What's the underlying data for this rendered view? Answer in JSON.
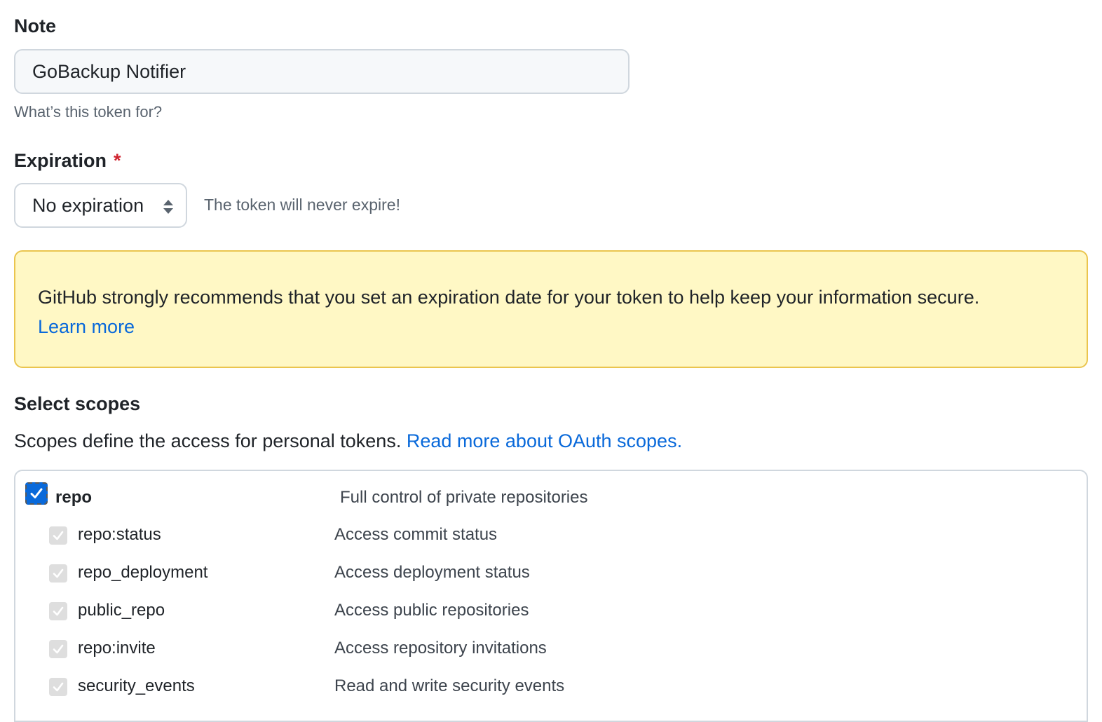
{
  "note": {
    "label": "Note",
    "value": "GoBackup Notifier",
    "hint": "What’s this token for?"
  },
  "expiration": {
    "label": "Expiration",
    "required_mark": "*",
    "selected": "No expiration",
    "hint": "The token will never expire!"
  },
  "warning": {
    "text": "GitHub strongly recommends that you set an expiration date for your token to help keep your information secure.",
    "link": "Learn more",
    "colors": {
      "background": "#fff8c5",
      "border": "#eac54f"
    }
  },
  "scopes": {
    "title": "Select scopes",
    "description": "Scopes define the access for personal tokens.",
    "link": "Read more about OAuth scopes.",
    "items": [
      {
        "name": "repo",
        "description": "Full control of private repositories",
        "checked": true
      },
      {
        "name": "repo:status",
        "description": "Access commit status",
        "checked": true
      },
      {
        "name": "repo_deployment",
        "description": "Access deployment status",
        "checked": true
      },
      {
        "name": "public_repo",
        "description": "Access public repositories",
        "checked": true
      },
      {
        "name": "repo:invite",
        "description": "Access repository invitations",
        "checked": true
      },
      {
        "name": "security_events",
        "description": "Read and write security events",
        "checked": true
      }
    ]
  },
  "colors": {
    "accent": "#0969da",
    "required": "#cf222e"
  }
}
